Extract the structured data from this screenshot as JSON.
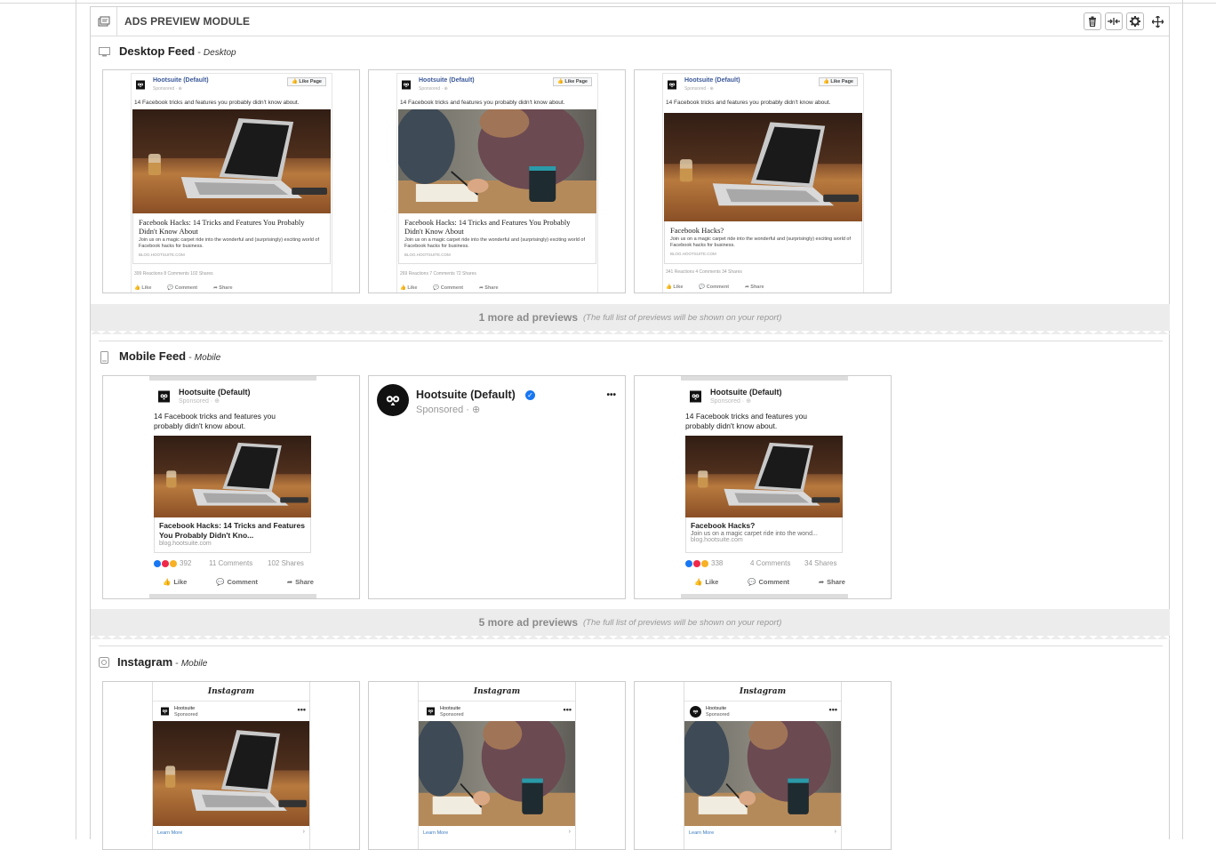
{
  "module": {
    "title": "ADS PREVIEW MODULE",
    "icon": "module-icon",
    "toolbar": {
      "delete": "trash-icon",
      "collapse": "collapse-arrows-icon",
      "settings": "gear-icon",
      "move": "move-icon"
    }
  },
  "desktop": {
    "title": "Desktop Feed",
    "subtitle": "Desktop",
    "more_count": "1 more ad previews",
    "more_note": "(The full list of previews will be shown on your report)",
    "cards": [
      {
        "page": "Hootsuite (Default)",
        "sponsored": "Sponsored · ⊕",
        "like_page": "👍 Like Page",
        "text": "14 Facebook tricks and features you probably didn't know about.",
        "image": "laptop",
        "title": "Facebook Hacks: 14 Tricks and Features You Probably Didn't Know About",
        "desc": "Join us on a magic carpet ride into the wonderful and (surprisingly) exciting world of Facebook hacks for business.",
        "url": "BLOG.HOOTSUITE.COM",
        "stats": "399 Reactions   8 Comments   102 Shares",
        "like": "👍 Like",
        "comment": "💬 Comment",
        "share": "➦ Share"
      },
      {
        "page": "Hootsuite (Default)",
        "sponsored": "Sponsored · ⊕",
        "like_page": "👍 Like Page",
        "text": "14 Facebook tricks and features you probably didn't know about.",
        "image": "people",
        "title": "Facebook Hacks: 14 Tricks and Features You Probably Didn't Know About",
        "desc": "Join us on a magic carpet ride into the wonderful and (surprisingly) exciting world of Facebook hacks for business.",
        "url": "BLOG.HOOTSUITE.COM",
        "stats": "269 Reactions   7 Comments   72 Shares",
        "like": "👍 Like",
        "comment": "💬 Comment",
        "share": "➦ Share"
      },
      {
        "page": "Hootsuite (Default)",
        "sponsored": "Sponsored · ⊕",
        "like_page": "👍 Like Page",
        "text": "14 Facebook tricks and features you probably didn't know about.",
        "image": "laptop",
        "title": "Facebook Hacks?",
        "desc": "Join us on a magic carpet ride into the wonderful and (surprisingly) exciting world of Facebook hacks for business.",
        "url": "BLOG.HOOTSUITE.COM",
        "stats": "341 Reactions   4 Comments   34 Shares",
        "like": "👍 Like",
        "comment": "💬 Comment",
        "share": "➦ Share"
      }
    ]
  },
  "mobile": {
    "title": "Mobile Feed",
    "subtitle": "Mobile",
    "more_count": "5 more ad previews",
    "more_note": "(The full list of previews will be shown on your report)",
    "cards": [
      {
        "page": "Hootsuite (Default)",
        "sponsored": "Sponsored · ⊕",
        "text": "14 Facebook tricks and features you probably didn't know about.",
        "title": "Facebook Hacks: 14 Tricks and Features You Probably Didn't Kno...",
        "url": "blog.hootsuite.com",
        "reactions": "392",
        "comments": "11 Comments",
        "shares": "102 Shares",
        "like": "Like",
        "comment": "Comment",
        "share": "Share"
      },
      {
        "page": "Hootsuite (Default)",
        "sponsored": "Sponsored · ⊕",
        "more": "•••"
      },
      {
        "page": "Hootsuite (Default)",
        "sponsored": "Sponsored · ⊕",
        "text": "14 Facebook tricks and features you probably didn't know about.",
        "title": "Facebook Hacks?",
        "desc": "Join us on a magic carpet ride into the wond...",
        "url": "blog.hootsuite.com",
        "reactions": "338",
        "comments": "4 Comments",
        "shares": "34 Shares",
        "like": "Like",
        "comment": "Comment",
        "share": "Share"
      }
    ]
  },
  "instagram": {
    "title": "Instagram",
    "subtitle": "Mobile",
    "cards": [
      {
        "logo": "Instagram",
        "account": "Hootsuite",
        "sponsored": "Sponsored",
        "more": "•••",
        "image": "laptop",
        "cta": "Learn More",
        "chevron": "›"
      },
      {
        "logo": "Instagram",
        "account": "Hootsuite",
        "sponsored": "Sponsored",
        "more": "•••",
        "image": "people",
        "cta": "Learn More",
        "chevron": "›"
      },
      {
        "logo": "Instagram",
        "account": "Hootsuite",
        "sponsored": "Sponsored",
        "more": "•••",
        "image": "people",
        "cta": "Learn More",
        "chevron": "›"
      }
    ]
  }
}
